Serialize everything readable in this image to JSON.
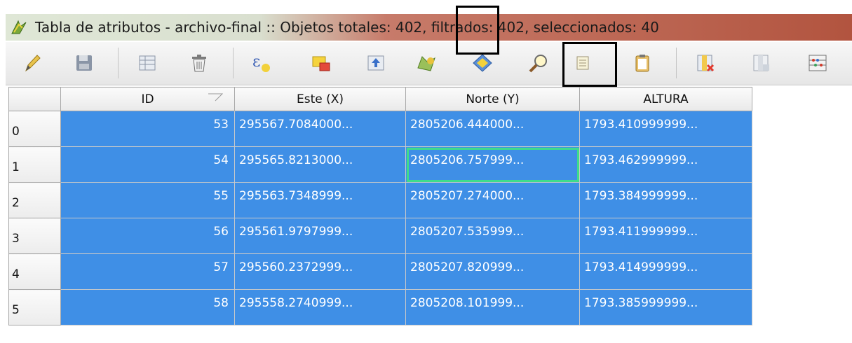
{
  "window": {
    "title": "Tabla de atributos - archivo-final :: Objetos totales: 402, filtrados: 402, seleccionados: 40",
    "app_icon": "qgis-icon"
  },
  "toolbar": {
    "buttons": [
      {
        "name": "toggle-editing-button",
        "icon": "pencil-icon"
      },
      {
        "name": "save-edits-button",
        "icon": "floppy-disk-icon"
      },
      {
        "name": "delete-selected-button",
        "icon": "table-delete-icon"
      },
      {
        "name": "trash-button",
        "icon": "trash-icon"
      },
      {
        "name": "select-by-expression-button",
        "icon": "expression-icon"
      },
      {
        "name": "unselect-all-button",
        "icon": "deselect-icon"
      },
      {
        "name": "move-selection-to-top-button",
        "icon": "move-top-icon"
      },
      {
        "name": "invert-selection-button",
        "icon": "invert-selection-icon"
      },
      {
        "name": "pan-to-selected-button",
        "icon": "pan-map-icon"
      },
      {
        "name": "zoom-to-selected-button",
        "icon": "zoom-magnifier-icon"
      },
      {
        "name": "copy-selected-rows-button",
        "icon": "copy-rows-icon"
      },
      {
        "name": "paste-features-button",
        "icon": "clipboard-icon"
      },
      {
        "name": "delete-field-button",
        "icon": "delete-column-icon"
      },
      {
        "name": "new-field-button",
        "icon": "new-column-icon"
      },
      {
        "name": "field-calculator-button",
        "icon": "abacus-icon"
      }
    ]
  },
  "table": {
    "columns": [
      "ID",
      "Este (X)",
      "Norte (Y)",
      "ALTURA"
    ],
    "rows": [
      {
        "row": "0",
        "cells": [
          "53",
          "295567.7084000...",
          "2805206.444000...",
          "1793.410999999..."
        ]
      },
      {
        "row": "1",
        "cells": [
          "54",
          "295565.8213000...",
          "2805206.757999...",
          "1793.462999999..."
        ]
      },
      {
        "row": "2",
        "cells": [
          "55",
          "295563.7348999...",
          "2805207.274000...",
          "1793.384999999..."
        ]
      },
      {
        "row": "3",
        "cells": [
          "56",
          "295561.9797999...",
          "2805207.535999...",
          "1793.411999999..."
        ]
      },
      {
        "row": "4",
        "cells": [
          "57",
          "295560.2372999...",
          "2805207.820999...",
          "1793.414999999..."
        ]
      },
      {
        "row": "5",
        "cells": [
          "58",
          "295558.2740999...",
          "2805208.101999...",
          "1793.385999999..."
        ]
      }
    ]
  },
  "colors": {
    "selection": "#3f8fe6",
    "current_cell_border": "#3fdc8a",
    "title_gradient_end": "#b2543f"
  }
}
